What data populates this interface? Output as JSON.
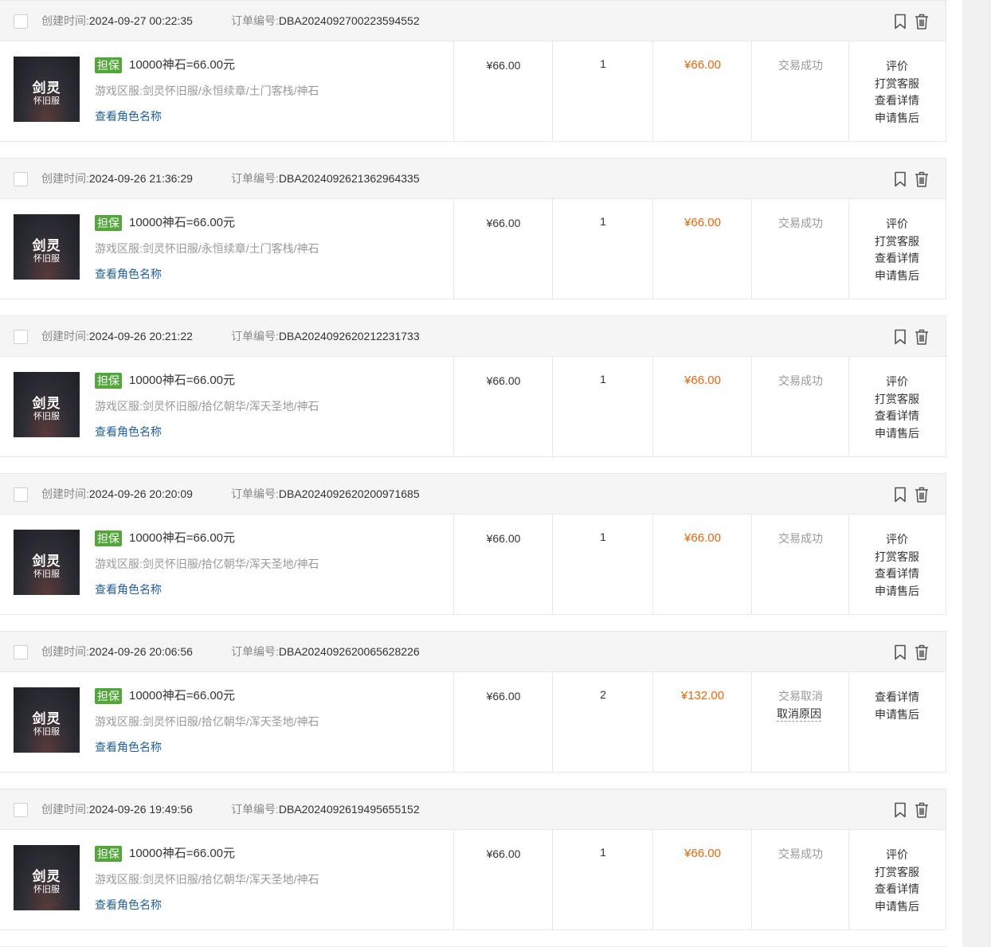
{
  "labels": {
    "created_time": "创建时间:",
    "order_no": "订单编号:",
    "guarantee_badge": "担保",
    "server_prefix": "游戏区服:",
    "view_role": "查看角色名称",
    "thumb_title": "剑灵",
    "thumb_sub": "怀旧服",
    "cancel_reason": "取消原因"
  },
  "icons": {
    "bookmark": "bookmark-icon",
    "trash": "trash-icon"
  },
  "colors": {
    "badge": "#52a63a",
    "total": "#e8660c",
    "link": "#1f5fa0",
    "header_bg": "#f5f5f5"
  },
  "orders": [
    {
      "created": "2024-09-27 00:22:35",
      "order_no": "DBA2024092700223594552",
      "goods": "10000神石=66.00元",
      "server": "剑灵怀旧服/永恒续章/土门客栈/神石",
      "price": "¥66.00",
      "qty": "1",
      "total": "¥66.00",
      "status": "交易成功",
      "actions": [
        "评价",
        "打赏客服",
        "查看详情",
        "申请售后"
      ]
    },
    {
      "created": "2024-09-26 21:36:29",
      "order_no": "DBA2024092621362964335",
      "goods": "10000神石=66.00元",
      "server": "剑灵怀旧服/永恒续章/土门客栈/神石",
      "price": "¥66.00",
      "qty": "1",
      "total": "¥66.00",
      "status": "交易成功",
      "actions": [
        "评价",
        "打赏客服",
        "查看详情",
        "申请售后"
      ]
    },
    {
      "created": "2024-09-26 20:21:22",
      "order_no": "DBA2024092620212231733",
      "goods": "10000神石=66.00元",
      "server": "剑灵怀旧服/拾亿朝华/浑天圣地/神石",
      "price": "¥66.00",
      "qty": "1",
      "total": "¥66.00",
      "status": "交易成功",
      "actions": [
        "评价",
        "打赏客服",
        "查看详情",
        "申请售后"
      ]
    },
    {
      "created": "2024-09-26 20:20:09",
      "order_no": "DBA2024092620200971685",
      "goods": "10000神石=66.00元",
      "server": "剑灵怀旧服/拾亿朝华/浑天圣地/神石",
      "price": "¥66.00",
      "qty": "1",
      "total": "¥66.00",
      "status": "交易成功",
      "actions": [
        "评价",
        "打赏客服",
        "查看详情",
        "申请售后"
      ]
    },
    {
      "created": "2024-09-26 20:06:56",
      "order_no": "DBA2024092620065628226",
      "goods": "10000神石=66.00元",
      "server": "剑灵怀旧服/拾亿朝华/浑天圣地/神石",
      "price": "¥66.00",
      "qty": "2",
      "total": "¥132.00",
      "status": "交易取消",
      "has_cancel_reason": true,
      "actions": [
        "查看详情",
        "申请售后"
      ]
    },
    {
      "created": "2024-09-26 19:49:56",
      "order_no": "DBA2024092619495655152",
      "goods": "10000神石=66.00元",
      "server": "剑灵怀旧服/拾亿朝华/浑天圣地/神石",
      "price": "¥66.00",
      "qty": "1",
      "total": "¥66.00",
      "status": "交易成功",
      "actions": [
        "评价",
        "打赏客服",
        "查看详情",
        "申请售后"
      ]
    }
  ]
}
